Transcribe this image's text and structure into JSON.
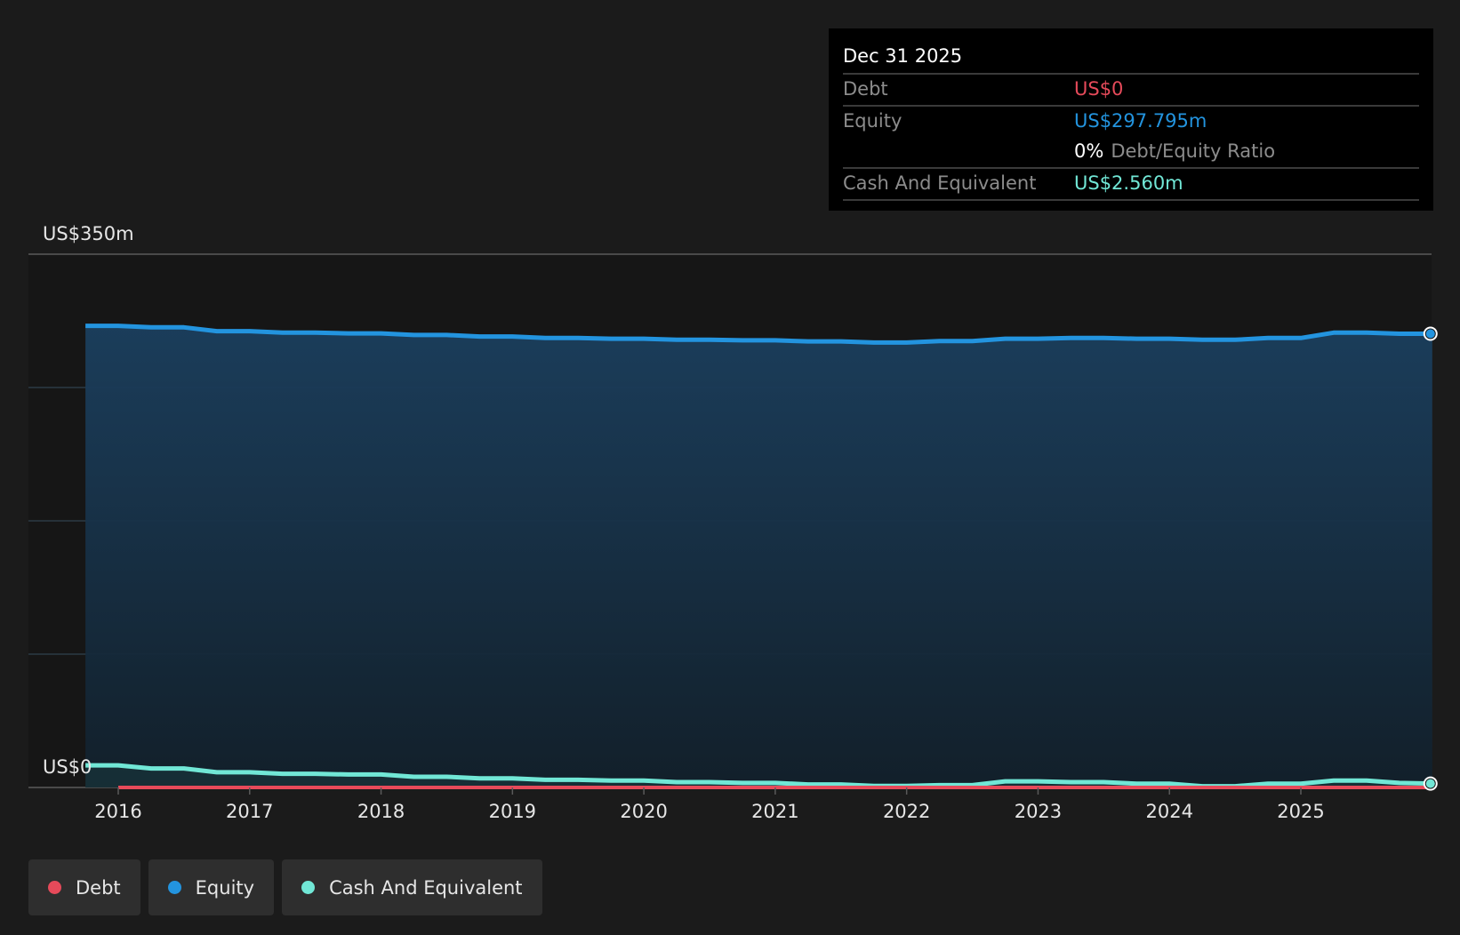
{
  "chart_data": {
    "type": "area",
    "x_unit": "year",
    "ylim": [
      0,
      350
    ],
    "y_unit": "US$ m",
    "y_tick_labels": [
      "US$350m",
      "US$0"
    ],
    "x_ticks": [
      2016,
      2017,
      2018,
      2019,
      2020,
      2021,
      2022,
      2023,
      2024,
      2025
    ],
    "grid": true,
    "legend_position": "bottom-left",
    "series": [
      {
        "name": "Debt",
        "color": "#e64a5a",
        "x": [
          2016.0,
          2017.0,
          2018.0,
          2019.0,
          2020.0,
          2021.0,
          2022.0,
          2023.0,
          2024.0,
          2025.0,
          2026.0
        ],
        "y": [
          0,
          0,
          0,
          0,
          0,
          0,
          0,
          0,
          0,
          0,
          0
        ]
      },
      {
        "name": "Equity",
        "color": "#2394df",
        "fill": true,
        "x": [
          2015.75,
          2016.0,
          2016.25,
          2016.5,
          2016.75,
          2017.0,
          2017.25,
          2017.5,
          2017.75,
          2018.0,
          2018.25,
          2018.5,
          2018.75,
          2019.0,
          2019.25,
          2019.5,
          2019.75,
          2020.0,
          2020.25,
          2020.5,
          2020.75,
          2021.0,
          2021.25,
          2021.5,
          2021.75,
          2022.0,
          2022.25,
          2022.5,
          2022.75,
          2023.0,
          2023.25,
          2023.5,
          2023.75,
          2024.0,
          2024.25,
          2024.5,
          2024.75,
          2025.0,
          2025.25,
          2025.5,
          2025.75,
          2026.0
        ],
        "y": [
          303.0,
          303.0,
          302.0,
          302.0,
          299.5,
          299.5,
          298.5,
          298.5,
          298.0,
          298.0,
          297.0,
          297.0,
          296.0,
          296.0,
          295.0,
          295.0,
          294.5,
          294.5,
          293.8,
          293.8,
          293.5,
          293.5,
          292.8,
          292.8,
          292.0,
          292.0,
          293.0,
          293.0,
          294.5,
          294.5,
          295.0,
          295.0,
          294.5,
          294.5,
          293.8,
          293.8,
          295.0,
          295.0,
          298.5,
          298.5,
          297.8,
          297.795
        ]
      },
      {
        "name": "Cash And Equivalent",
        "color": "#71e7d6",
        "fill": true,
        "x": [
          2015.75,
          2016.0,
          2016.25,
          2016.5,
          2016.75,
          2017.0,
          2017.25,
          2017.5,
          2017.75,
          2018.0,
          2018.25,
          2018.5,
          2018.75,
          2019.0,
          2019.25,
          2019.5,
          2019.75,
          2020.0,
          2020.25,
          2020.5,
          2020.75,
          2021.0,
          2021.25,
          2021.5,
          2021.75,
          2022.0,
          2022.25,
          2022.5,
          2022.75,
          2023.0,
          2023.25,
          2023.5,
          2023.75,
          2024.0,
          2024.25,
          2024.5,
          2024.75,
          2025.0,
          2025.25,
          2025.5,
          2025.75,
          2026.0
        ],
        "y": [
          14.5,
          14.5,
          12.5,
          12.5,
          10.0,
          10.0,
          9.0,
          9.0,
          8.5,
          8.5,
          7.0,
          7.0,
          6.0,
          6.0,
          5.0,
          5.0,
          4.5,
          4.5,
          3.5,
          3.5,
          3.0,
          3.0,
          2.0,
          2.0,
          1.0,
          1.0,
          1.5,
          1.5,
          4.0,
          4.0,
          3.5,
          3.5,
          2.5,
          2.5,
          0.8,
          0.8,
          2.5,
          2.5,
          4.5,
          4.5,
          3.0,
          2.56
        ]
      }
    ]
  },
  "tooltip": {
    "date": "Dec 31 2025",
    "debt_label": "Debt",
    "debt_value": "US$0",
    "equity_label": "Equity",
    "equity_value": "US$297.795m",
    "ratio_pct": "0%",
    "ratio_label": "Debt/Equity Ratio",
    "cash_label": "Cash And Equivalent",
    "cash_value": "US$2.560m"
  },
  "legend": {
    "debt": "Debt",
    "equity": "Equity",
    "cash": "Cash And Equivalent"
  }
}
